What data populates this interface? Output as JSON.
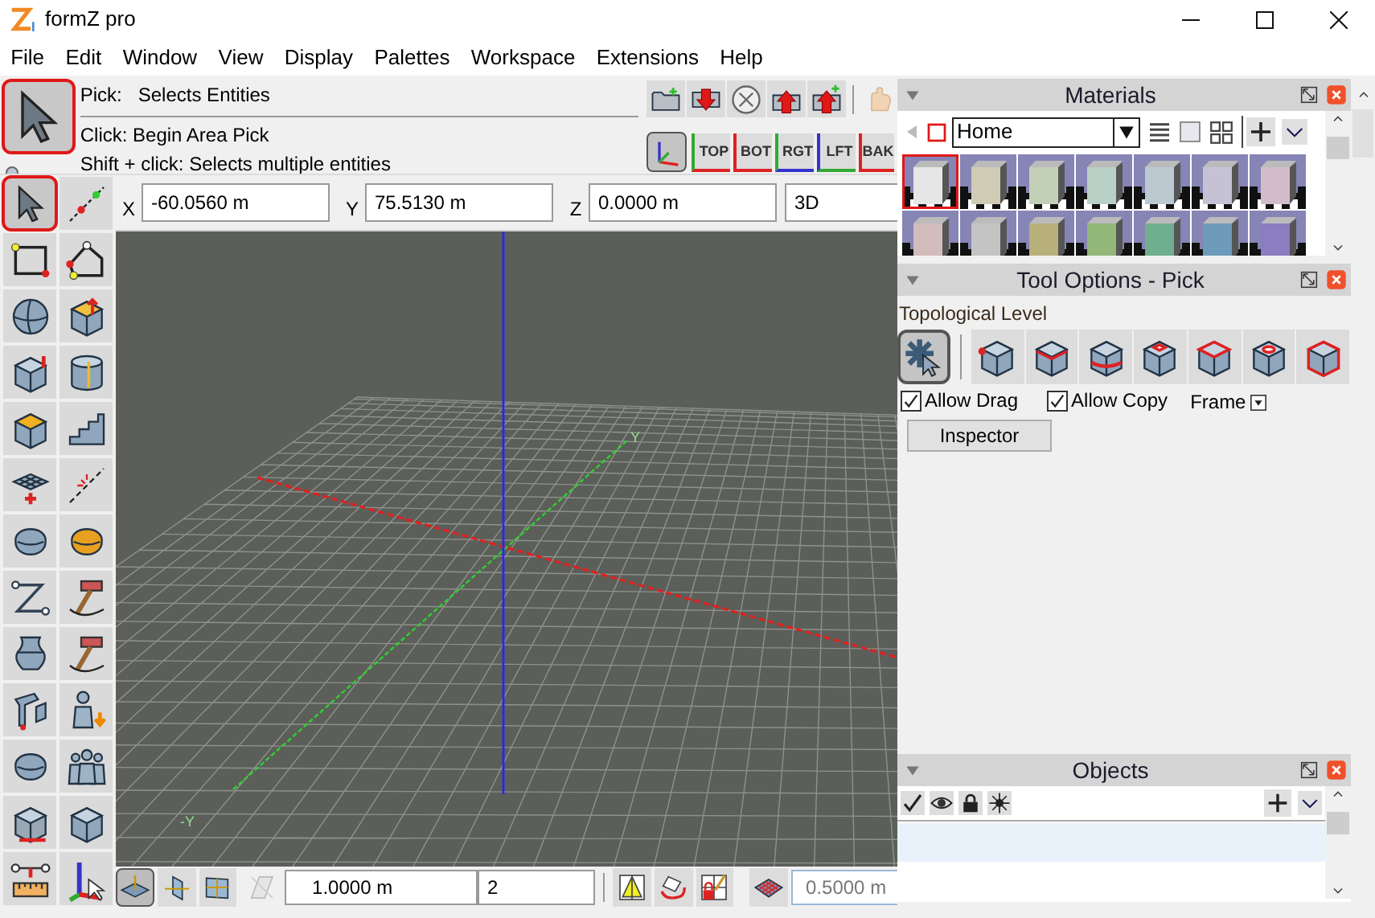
{
  "window": {
    "title": "formZ pro"
  },
  "menu": [
    "File",
    "Edit",
    "Window",
    "View",
    "Display",
    "Palettes",
    "Workspace",
    "Extensions",
    "Help"
  ],
  "tool_header": {
    "name": "Pick:",
    "description": "Selects Entities",
    "hints": [
      "Click: Begin Area Pick",
      "Shift + click: Selects multiple entities"
    ]
  },
  "view_buttons": [
    "TOP",
    "BOT",
    "RGT",
    "LFT",
    "BAK"
  ],
  "coordinates": [
    {
      "label": "X",
      "value": "-60.0560 m"
    },
    {
      "label": "Y",
      "value": "75.5130 m"
    },
    {
      "label": "Z",
      "value": "0.0000 m"
    }
  ],
  "view_mode": "3D",
  "tools": [
    {
      "selected": true
    },
    {
      "selected": false
    },
    {
      "selected": false
    },
    {
      "selected": false
    },
    {
      "selected": false
    },
    {
      "selected": false
    },
    {
      "selected": false
    },
    {
      "selected": false
    },
    {
      "selected": false
    },
    {
      "selected": false
    },
    {
      "selected": false
    },
    {
      "selected": false
    },
    {
      "selected": false
    },
    {
      "selected": false
    },
    {
      "selected": false
    },
    {
      "selected": false
    },
    {
      "selected": false
    },
    {
      "selected": false
    },
    {
      "selected": false
    },
    {
      "selected": false
    },
    {
      "selected": false
    },
    {
      "selected": false
    },
    {
      "selected": false
    },
    {
      "selected": false
    },
    {
      "selected": false
    },
    {
      "selected": false
    }
  ],
  "viewport": {
    "axis_labels": [
      "Y",
      "-Y"
    ]
  },
  "bottom_bar": {
    "grid_buttons": [
      {
        "selected": true
      },
      {
        "selected": false
      },
      {
        "selected": false
      }
    ],
    "grid_size": "1.0000 m",
    "grid_count": "2",
    "grid_spacing": "0.5000 m"
  },
  "materials": {
    "title": "Materials",
    "library": "Home",
    "swatches": [
      {
        "color": "#e6e6e6",
        "selected": true
      },
      {
        "color": "#cfcbb5",
        "selected": false
      },
      {
        "color": "#c3d0b8",
        "selected": false
      },
      {
        "color": "#b9d0c6",
        "selected": false
      },
      {
        "color": "#bcc9d0",
        "selected": false
      },
      {
        "color": "#c6c2d6",
        "selected": false
      },
      {
        "color": "#d2bccb",
        "selected": false
      },
      {
        "color": "#d2bcbc",
        "selected": false
      },
      {
        "color": "#c4c4c4",
        "selected": false
      },
      {
        "color": "#b8b07a",
        "selected": false
      },
      {
        "color": "#92b778",
        "selected": false
      },
      {
        "color": "#6fae8e",
        "selected": false
      },
      {
        "color": "#6e9bba",
        "selected": false
      },
      {
        "color": "#8c7cc0",
        "selected": false
      }
    ]
  },
  "tool_options": {
    "title": "Tool Options - Pick",
    "section": "Topological Level",
    "levels": [
      {
        "selected": true
      },
      {
        "selected": false
      },
      {
        "selected": false
      },
      {
        "selected": false
      },
      {
        "selected": false
      },
      {
        "selected": false
      },
      {
        "selected": false
      },
      {
        "selected": false
      }
    ],
    "checkboxes": [
      {
        "label": "Allow Drag",
        "checked": true
      },
      {
        "label": "Allow Copy",
        "checked": true
      }
    ],
    "frame_label": "Frame",
    "button": "Inspector"
  },
  "objects": {
    "title": "Objects"
  }
}
